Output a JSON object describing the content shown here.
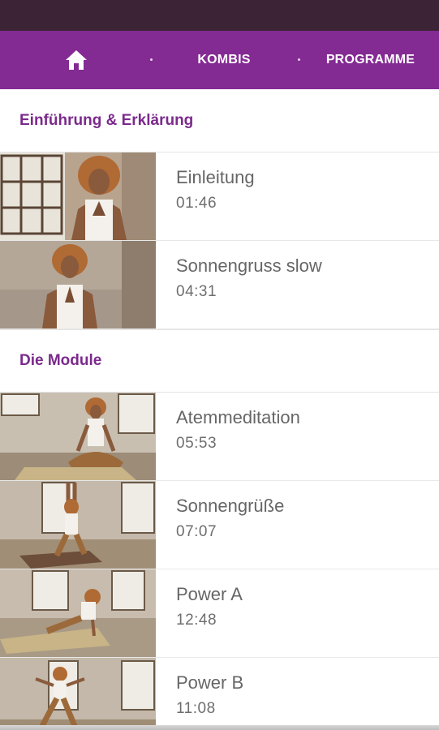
{
  "tabs": [
    {
      "label": "",
      "icon": "home-icon"
    },
    {
      "label": "KOMBIS"
    },
    {
      "label": "PROGRAMME",
      "selected": true
    }
  ],
  "colors": {
    "status_bar": "#3d2336",
    "tab_bar": "#842a93",
    "section_header_text": "#7b2a8c",
    "item_text": "#666666"
  },
  "sections": [
    {
      "title": "Einführung  & Erklärung",
      "items": [
        {
          "title": "Einleitung",
          "duration": "01:46"
        },
        {
          "title": "Sonnengruss slow",
          "duration": "04:31"
        }
      ]
    },
    {
      "title": "Die Module",
      "items": [
        {
          "title": "Atemmeditation",
          "duration": "05:53"
        },
        {
          "title": "Sonnengrüße",
          "duration": "07:07"
        },
        {
          "title": "Power A",
          "duration": "12:48"
        },
        {
          "title": "Power B",
          "duration": "11:08"
        }
      ]
    }
  ]
}
